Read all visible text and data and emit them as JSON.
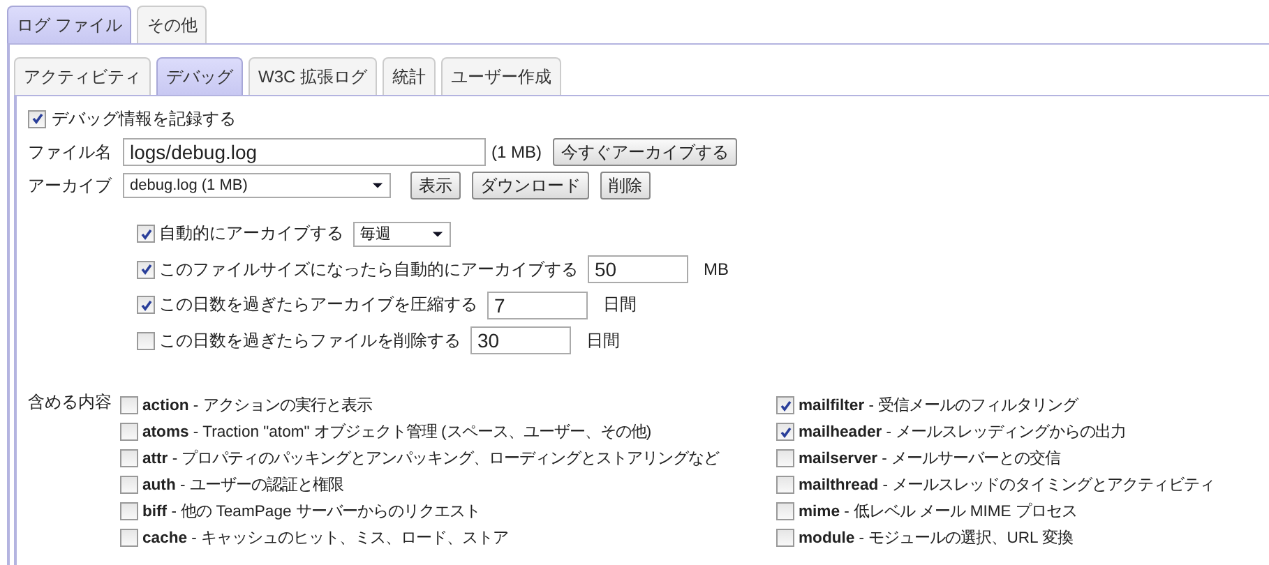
{
  "outer_tabs": [
    {
      "label": "ログ ファイル",
      "selected": true
    },
    {
      "label": "その他",
      "selected": false
    }
  ],
  "inner_tabs": [
    {
      "label": "アクティビティ",
      "selected": false
    },
    {
      "label": "デバッグ",
      "selected": true
    },
    {
      "label": "W3C 拡張ログ",
      "selected": false
    },
    {
      "label": "統計",
      "selected": false
    },
    {
      "label": "ユーザー作成",
      "selected": false
    }
  ],
  "debug_logging": {
    "label": "デバッグ情報を記録する",
    "checked": true
  },
  "file": {
    "label": "ファイル名",
    "value": "logs/debug.log",
    "size": "(1 MB)",
    "button": "今すぐアーカイブする"
  },
  "archive": {
    "label": "アーカイブ",
    "selected_value": "debug.log (1 MB)",
    "buttons": [
      "表示",
      "ダウンロード",
      "削除"
    ]
  },
  "options": [
    {
      "kind": "select",
      "label": "自動的にアーカイブする",
      "checked": true,
      "value": "毎週"
    },
    {
      "kind": "input",
      "label": "このファイルサイズになったら自動的にアーカイブする",
      "checked": true,
      "value": "50",
      "unit": "MB"
    },
    {
      "kind": "input",
      "label": "この日数を過ぎたらアーカイブを圧縮する",
      "checked": true,
      "value": "7",
      "unit": "日間"
    },
    {
      "kind": "input",
      "label": "この日数を過ぎたらファイルを削除する",
      "checked": false,
      "value": "30",
      "unit": "日間"
    }
  ],
  "include": {
    "label": "含める内容",
    "left": [
      {
        "name": "action",
        "description": "- アクションの実行と表示",
        "checked": false
      },
      {
        "name": "atoms",
        "description": "- Traction \"atom\" オブジェクト管理 (スペース、ユーザー、その他)",
        "checked": false
      },
      {
        "name": "attr",
        "description": "- プロパティのパッキングとアンパッキング、ローディングとストアリングなど",
        "checked": false
      },
      {
        "name": "auth",
        "description": "- ユーザーの認証と権限",
        "checked": false
      },
      {
        "name": "biff",
        "description": "- 他の TeamPage サーバーからのリクエスト",
        "checked": false
      },
      {
        "name": "cache",
        "description": "- キャッシュのヒット、ミス、ロード、ストア",
        "checked": false
      }
    ],
    "right": [
      {
        "name": "mailfilter",
        "description": "- 受信メールのフィルタリング",
        "checked": true
      },
      {
        "name": "mailheader",
        "description": "- メールスレッディングからの出力",
        "checked": true
      },
      {
        "name": "mailserver",
        "description": "- メールサーバーとの交信",
        "checked": false
      },
      {
        "name": "mailthread",
        "description": "- メールスレッドのタイミングとアクティビティ",
        "checked": false
      },
      {
        "name": "mime",
        "description": "- 低レベル メール MIME プロセス",
        "checked": false
      },
      {
        "name": "module",
        "description": "- モジュールの選択、URL 変換",
        "checked": false
      }
    ]
  }
}
